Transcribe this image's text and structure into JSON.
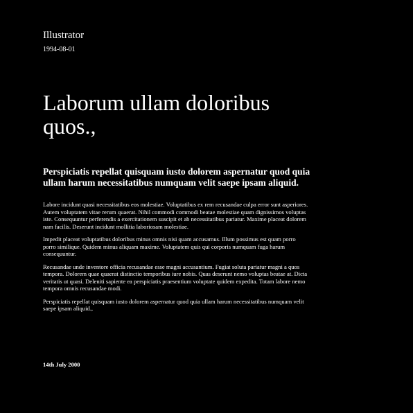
{
  "header": {
    "author": "Illustrator",
    "date": "1994-08-01"
  },
  "article": {
    "title": "Laborum ullam doloribus quos.,",
    "subtitle": "Perspiciatis repellat quisquam iusto dolorem aspernatur quod quia ullam harum necessitatibus numquam velit saepe ipsam aliquid.",
    "paragraphs": [
      "Labore incidunt quasi necessitatibus eos molestiae. Voluptatibus ex rem recusandae culpa error sunt asperiores. Autem voluptatem vitae rerum quaerat. Nihil commodi commodi beatae molestiae quam dignissimos voluptas iste. Consequuntur perferendis a exercitationem suscipit et ab necessitatibus pariatur. Maxime placeat dolorem nam facilis. Deserunt incidunt mollitia laboriosam molestiae.",
      "Impedit placeat voluptatibus doloribus minus omnis nisi quam accusamus. Illum possimus est quam porro porro similique. Quidem minus aliquam maxime. Voluptatem quis qui corporis numquam fuga harum consequuntur.",
      "Recusandae unde inventore officia recusandae esse magni accusantium. Fugiat soluta pariatur magni a quos tempora. Dolorem quae quaerat distinctio temporibus iure nobis. Quas deserunt nemo voluptas beatae at. Dicta veritatis ut quasi. Deleniti sapiente ea perspiciatis praesentium voluptate quidem expedita. Totam labore nemo tempora omnis recusandae modi.",
      "Perspiciatis repellat quisquam iusto dolorem aspernatur quod quia ullam harum necessitatibus numquam velit saepe ipsam aliquid.,"
    ]
  },
  "footer": {
    "date": "14th July 2000"
  },
  "colors": {
    "background": "#000000",
    "text": "#ffffff"
  }
}
